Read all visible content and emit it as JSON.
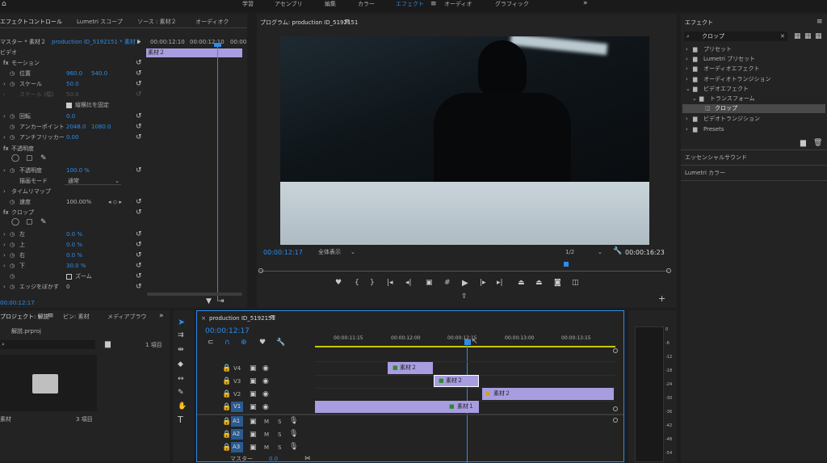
{
  "workspace": {
    "tabs": [
      "学習",
      "アセンブリ",
      "編集",
      "カラー",
      "エフェクト",
      "オーディオ",
      "グラフィック"
    ],
    "active": "エフェクト"
  },
  "effect_controls": {
    "tabs": [
      "エフェクトコントロール",
      "Lumetri スコープ",
      "ソース : 素材２",
      "オーディオク"
    ],
    "source": "マスター * 素材２",
    "sequence": "production ID_5192151 * 素材２",
    "section": "ビデオ",
    "tc1": "00:00:12:10",
    "tc2": "00:00",
    "clip": "素材２",
    "motion": "モーション",
    "pos_label": "位置",
    "pos_x": "960.0",
    "pos_y": "540.0",
    "scale_label": "スケール",
    "scale": "50.0",
    "scalew_label": "スケール (幅)",
    "scalew": "50.0",
    "aspect": "縦横比を固定",
    "rot_label": "回転",
    "rot": "0.0",
    "anchor_label": "アンカーポイント",
    "anchor_x": "2048.0",
    "anchor_y": "1080.0",
    "flicker_label": "アンチフリッカー",
    "flicker": "0.00",
    "opacity_title": "不透明度",
    "opacity_label": "不透明度",
    "opacity": "100.0 %",
    "blend_label": "描画モード",
    "blend": "通常",
    "remap": "タイムリマップ",
    "speed_label": "速度",
    "speed": "100.00%",
    "crop_title": "クロップ",
    "left": "左",
    "left_v": "0.0 %",
    "top": "上",
    "top_v": "0.0 %",
    "right": "右",
    "right_v": "0.0 %",
    "bottom": "下",
    "bottom_v": "30.0 %",
    "zoom": "ズーム",
    "feather": "エッジをぼかす",
    "feather_v": "0",
    "tc_bottom": "00:00:12:17"
  },
  "program": {
    "title": "プログラム: production ID_5192151",
    "tc": "00:00:12:17",
    "fit": "全体表示",
    "res": "1/2",
    "dur": "00:00:16:23"
  },
  "project": {
    "tabs": [
      "プロジェクト: 解説",
      "ビン: 素材",
      "メディアブラウ"
    ],
    "file": "解説.prproj",
    "count": "1 項目",
    "bin": "素材",
    "bin_count": "3 項目"
  },
  "timeline": {
    "title": "production ID_5192151",
    "tc": "00:00:12:17",
    "ruler": [
      "00:00:11:15",
      "00:00:12:00",
      "00:00:12:15",
      "00:00:13:00",
      "00:00:13:15"
    ],
    "video_tracks": [
      "V4",
      "V3",
      "V2",
      "V1"
    ],
    "audio_tracks": [
      "A1",
      "A2",
      "A3"
    ],
    "master": "マスター",
    "master_v": "0.0",
    "clips": [
      {
        "track": "V4",
        "label": "素材２"
      },
      {
        "track": "V3",
        "label": "素材２"
      },
      {
        "track": "V2",
        "label": "素材２"
      },
      {
        "track": "V1",
        "label": "素材１"
      }
    ],
    "meter": [
      "0",
      "-6",
      "-12",
      "-18",
      "-24",
      "-30",
      "-36",
      "-42",
      "-48",
      "-54"
    ]
  },
  "effects": {
    "title": "エフェクト",
    "search": "クロップ",
    "tree": [
      "プリセット",
      "Lumetri プリセット",
      "オーディオエフェクト",
      "オーディオトランジション",
      "ビデオエフェクト",
      "トランスフォーム",
      "クロップ",
      "ビデオトランジション",
      "Presets"
    ],
    "essential": "エッセンシャルサウンド",
    "lumetri": "Lumetri カラー"
  }
}
